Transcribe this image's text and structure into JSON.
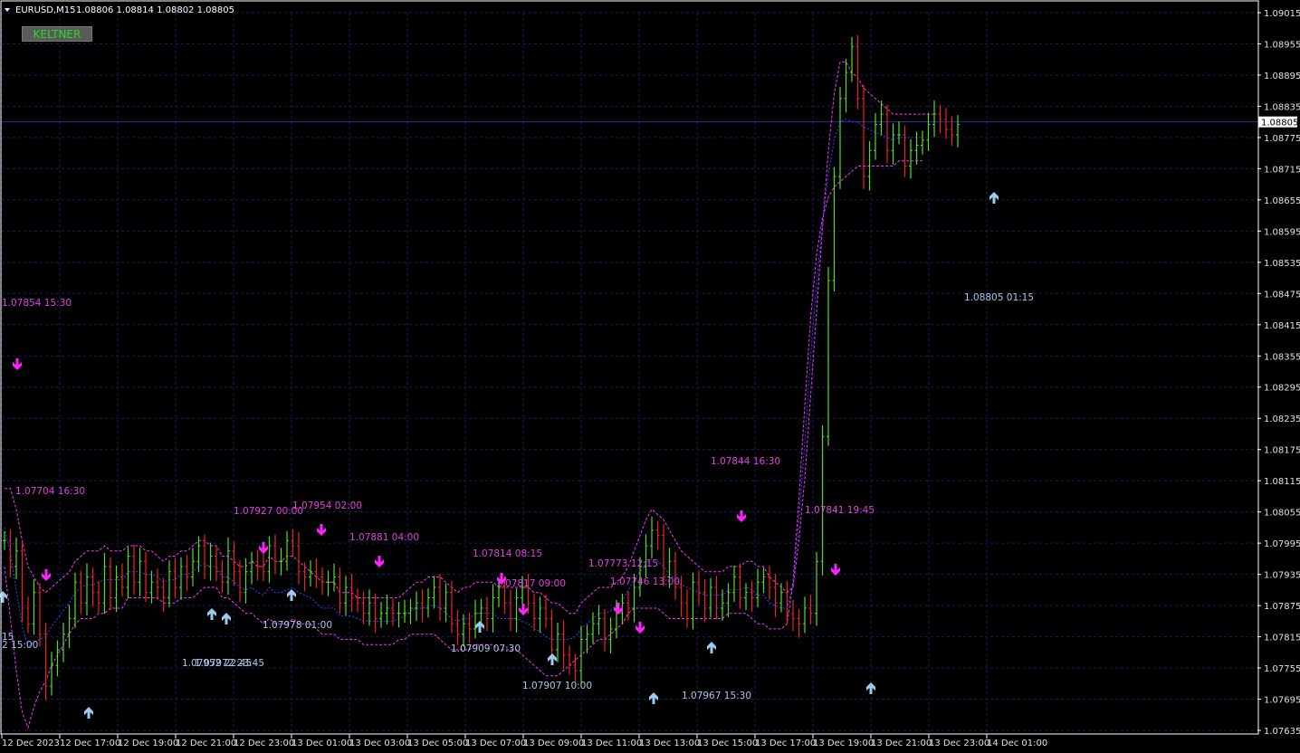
{
  "header": {
    "symbol": "EURUSD,M15",
    "ohlc": "1.08806 1.08814 1.08802 1.08805",
    "menu_icon": "triangle-down-icon"
  },
  "keltner_button": {
    "label": "KELTNER"
  },
  "colors": {
    "background": "#000000",
    "grid": "#1a1a5c",
    "frame": "#ffffff",
    "bull_bar": "#55dd22",
    "bear_bar": "#ee2222",
    "band_upper": "#ff33ff",
    "band_lower": "#ff33ff",
    "band_mid": "#3344ff",
    "sell_arrow": "#ff22ff",
    "buy_arrow": "#99ccee",
    "price_line": "#2233aa",
    "price_tag_bg": "#ffffff"
  },
  "chart_data": {
    "type": "candlestick-bars",
    "symbol": "EURUSD",
    "timeframe": "M15",
    "ylim": [
      1.07635,
      1.09015
    ],
    "y_ticks": [
      "1.09015",
      "1.08955",
      "1.08895",
      "1.08835",
      "1.08775",
      "1.08715",
      "1.08655",
      "1.08595",
      "1.08535",
      "1.08475",
      "1.08415",
      "1.08355",
      "1.08295",
      "1.08235",
      "1.08175",
      "1.08115",
      "1.08055",
      "1.07995",
      "1.07935",
      "1.07875",
      "1.07815",
      "1.07755",
      "1.07695",
      "1.07635"
    ],
    "x_ticks": [
      "12 Dec 2023",
      "12 Dec 17:00",
      "12 Dec 19:00",
      "12 Dec 21:00",
      "12 Dec 23:00",
      "13 Dec 01:00",
      "13 Dec 03:00",
      "13 Dec 05:00",
      "13 Dec 07:00",
      "13 Dec 09:00",
      "13 Dec 11:00",
      "13 Dec 13:00",
      "13 Dec 15:00",
      "13 Dec 17:00",
      "13 Dec 19:00",
      "13 Dec 21:00",
      "13 Dec 23:00",
      "14 Dec 01:00"
    ],
    "current_price": "1.08805",
    "grid": true,
    "close_series": [
      1.08,
      1.0795,
      1.0798,
      1.0787,
      1.0784,
      1.079,
      1.0782,
      1.0772,
      1.0776,
      1.0779,
      1.0782,
      1.0785,
      1.0792,
      1.0788,
      1.0793,
      1.079,
      1.0788,
      1.0795,
      1.0789,
      1.0793,
      1.0791,
      1.0797,
      1.0792,
      1.0796,
      1.079,
      1.0792,
      1.0791,
      1.0789,
      1.0794,
      1.0791,
      1.0795,
      1.0793,
      1.0796,
      1.0799,
      1.0795,
      1.0797,
      1.0794,
      1.0792,
      1.0798,
      1.0794,
      1.079,
      1.0794,
      1.0796,
      1.0795,
      1.0794,
      1.0799,
      1.0796,
      1.0796,
      1.08,
      1.0799,
      1.0794,
      1.0793,
      1.0794,
      1.0793,
      1.0792,
      1.0792,
      1.0793,
      1.0788,
      1.0791,
      1.0789,
      1.0788,
      1.0786,
      1.0788,
      1.0785,
      1.0786,
      1.0787,
      1.0786,
      1.0786,
      1.0786,
      1.0787,
      1.0788,
      1.0787,
      1.0789,
      1.0791,
      1.0787,
      1.079,
      1.0784,
      1.0782,
      1.0784,
      1.0783,
      1.0786,
      1.0787,
      1.0785,
      1.0789,
      1.0791,
      1.0788,
      1.0785,
      1.0789,
      1.0791,
      1.0788,
      1.0785,
      1.0787,
      1.0785,
      1.0779,
      1.0782,
      1.0778,
      1.0776,
      1.0775,
      1.0781,
      1.0782,
      1.0784,
      1.0785,
      1.0781,
      1.0783,
      1.0786,
      1.0788,
      1.0787,
      1.0791,
      1.0795,
      1.0799,
      1.0802,
      1.0801,
      1.0793,
      1.0796,
      1.0791,
      1.0788,
      1.0785,
      1.0792,
      1.079,
      1.0787,
      1.0791,
      1.0787,
      1.0788,
      1.079,
      1.0793,
      1.0789,
      1.079,
      1.0789,
      1.0792,
      1.0793,
      1.0791,
      1.0788,
      1.079,
      1.0786,
      1.0785,
      1.0784,
      1.0787,
      1.0786,
      1.0796,
      1.082,
      1.085,
      1.087,
      1.0885,
      1.089,
      1.0895,
      1.0885,
      1.087,
      1.0875,
      1.088,
      1.0882,
      1.0875,
      1.0878,
      1.0878,
      1.0872,
      1.0875,
      1.0876,
      1.0877,
      1.088,
      1.0882,
      1.0881,
      1.0879,
      1.0878,
      1.088
    ],
    "upper_band": [
      1.081,
      1.081,
      1.0806,
      1.08,
      1.0795,
      1.0793,
      1.0791,
      1.079,
      1.0791,
      1.0792,
      1.0793,
      1.0794,
      1.0796,
      1.0797,
      1.0798,
      1.0798,
      1.0798,
      1.0799,
      1.0798,
      1.0798,
      1.0798,
      1.0799,
      1.0799,
      1.0799,
      1.0798,
      1.0798,
      1.0797,
      1.0796,
      1.0797,
      1.0797,
      1.0798,
      1.0798,
      1.0799,
      1.08,
      1.08,
      1.0799,
      1.0799,
      1.0797,
      1.0797,
      1.0796,
      1.0795,
      1.0795,
      1.0796,
      1.0795,
      1.0795,
      1.0797,
      1.0796,
      1.0796,
      1.0797,
      1.0797,
      1.0796,
      1.0795,
      1.0794,
      1.0793,
      1.0792,
      1.0792,
      1.0792,
      1.079,
      1.079,
      1.079,
      1.0789,
      1.0789,
      1.0789,
      1.0789,
      1.0789,
      1.0789,
      1.0789,
      1.0789,
      1.079,
      1.0791,
      1.0792,
      1.0792,
      1.0793,
      1.0793,
      1.0793,
      1.0792,
      1.0791,
      1.079,
      1.0791,
      1.0791,
      1.0792,
      1.0792,
      1.0792,
      1.0792,
      1.0791,
      1.0791,
      1.0791,
      1.0791,
      1.0791,
      1.0791,
      1.079,
      1.079,
      1.0789,
      1.0788,
      1.0788,
      1.0787,
      1.0786,
      1.0786,
      1.0788,
      1.0789,
      1.079,
      1.0791,
      1.0791,
      1.0791,
      1.0792,
      1.0793,
      1.0795,
      1.0798,
      1.0801,
      1.0804,
      1.0806,
      1.0805,
      1.0804,
      1.0802,
      1.08,
      1.0798,
      1.0797,
      1.0796,
      1.0795,
      1.0794,
      1.0794,
      1.0794,
      1.0794,
      1.0795,
      1.0795,
      1.0795,
      1.0796,
      1.0796,
      1.0795,
      1.0795,
      1.0793,
      1.0792,
      1.0791,
      1.079,
      1.0791,
      1.08,
      1.0812,
      1.0828,
      1.0844,
      1.086,
      1.0875,
      1.0886,
      1.0892,
      1.0892,
      1.089,
      1.0889,
      1.0887,
      1.0886,
      1.0885,
      1.0884,
      1.0883,
      1.0882,
      1.0882,
      1.0882,
      1.0882,
      1.0882,
      1.0882,
      1.0882,
      1.0882
    ],
    "lower_band": [
      1.0795,
      1.0785,
      1.0775,
      1.0767,
      1.0764,
      1.0768,
      1.0771,
      1.0773,
      1.0776,
      1.0778,
      1.078,
      1.0782,
      1.0784,
      1.0785,
      1.0785,
      1.0785,
      1.0786,
      1.0786,
      1.0787,
      1.0787,
      1.0787,
      1.0789,
      1.0789,
      1.0789,
      1.0789,
      1.0789,
      1.0789,
      1.0788,
      1.0788,
      1.0788,
      1.0789,
      1.0789,
      1.0789,
      1.079,
      1.0791,
      1.0791,
      1.0791,
      1.0789,
      1.0789,
      1.0788,
      1.0787,
      1.0786,
      1.0786,
      1.0785,
      1.0784,
      1.0785,
      1.0784,
      1.0784,
      1.0784,
      1.0785,
      1.0784,
      1.0784,
      1.0784,
      1.0783,
      1.0782,
      1.0782,
      1.0782,
      1.0781,
      1.0781,
      1.0781,
      1.0781,
      1.078,
      1.078,
      1.078,
      1.078,
      1.078,
      1.078,
      1.0781,
      1.0781,
      1.0782,
      1.0782,
      1.0782,
      1.0782,
      1.0782,
      1.0781,
      1.078,
      1.0779,
      1.0779,
      1.0779,
      1.0779,
      1.078,
      1.078,
      1.078,
      1.078,
      1.0779,
      1.0779,
      1.0779,
      1.0779,
      1.0778,
      1.0777,
      1.0776,
      1.0775,
      1.0774,
      1.0774,
      1.0774,
      1.0775,
      1.0776,
      1.0777,
      1.0778,
      1.0779,
      1.078,
      1.0781,
      1.0781,
      1.0782,
      1.0783,
      1.0784,
      1.0786,
      1.0787,
      1.0787,
      1.0787,
      1.0787,
      1.0787,
      1.0786,
      1.0785,
      1.0785,
      1.0785,
      1.0785,
      1.0785,
      1.0785,
      1.0785,
      1.0785,
      1.0785,
      1.0785,
      1.0786,
      1.0786,
      1.0786,
      1.0786,
      1.0785,
      1.0784,
      1.0784,
      1.0783,
      1.0783,
      1.0783,
      1.0784,
      1.0792,
      1.0808,
      1.0826,
      1.0843,
      1.0855,
      1.0862,
      1.0866,
      1.0868,
      1.0869,
      1.087,
      1.0871,
      1.0872,
      1.0872,
      1.0872,
      1.0872,
      1.0872,
      1.0872,
      1.0872,
      1.0873,
      1.0873,
      1.0873,
      1.0873,
      1.0873
    ],
    "annotations": [
      {
        "text": "1.07854 15:30",
        "kind": "sell",
        "price": 1.0846
      },
      {
        "text": "1.07704 16:30",
        "kind": "sell",
        "price": 1.081
      },
      {
        "text": "1.07927 00:00",
        "kind": "sell",
        "price": 1.0805
      },
      {
        "text": "1.07954 02:00",
        "kind": "sell",
        "price": 1.0806
      },
      {
        "text": "1.07881 04:00",
        "kind": "sell",
        "price": 1.0801
      },
      {
        "text": "1.07814 08:15",
        "kind": "sell",
        "price": 1.0797
      },
      {
        "text": "1.07817 09:00",
        "kind": "sell",
        "price": 1.0792
      },
      {
        "text": "1.07773 12:15",
        "kind": "sell",
        "price": 1.0795
      },
      {
        "text": "1.07746 13:00",
        "kind": "sell",
        "price": 1.0793
      },
      {
        "text": "1.07844 16:30",
        "kind": "sell",
        "price": 1.0815
      },
      {
        "text": "1.07841 19:45",
        "kind": "sell",
        "price": 1.0805
      },
      {
        "text": "1.07978 01:00",
        "kind": "buy",
        "price": 1.0784
      },
      {
        "text": "1.07909 07:30",
        "kind": "buy",
        "price": 1.0781
      },
      {
        "text": "1.07907 10:00",
        "kind": "buy",
        "price": 1.0774
      },
      {
        "text": "1.07967 15:30",
        "kind": "buy",
        "price": 1.0771
      },
      {
        "text": "1.08805 01:15",
        "kind": "buy",
        "price": 1.085
      },
      {
        "text": "1.07952 22:45",
        "kind": "buy",
        "price": 1.0778
      },
      {
        "text": "1.07972 23:45",
        "kind": "buy",
        "price": 1.0778
      },
      {
        "text": "15",
        "kind": "buy",
        "price": 1.0782
      },
      {
        "text": "2 15:00",
        "kind": "buy",
        "price": 1.0781
      }
    ],
    "sell_arrows": 14,
    "buy_arrows": 12
  }
}
